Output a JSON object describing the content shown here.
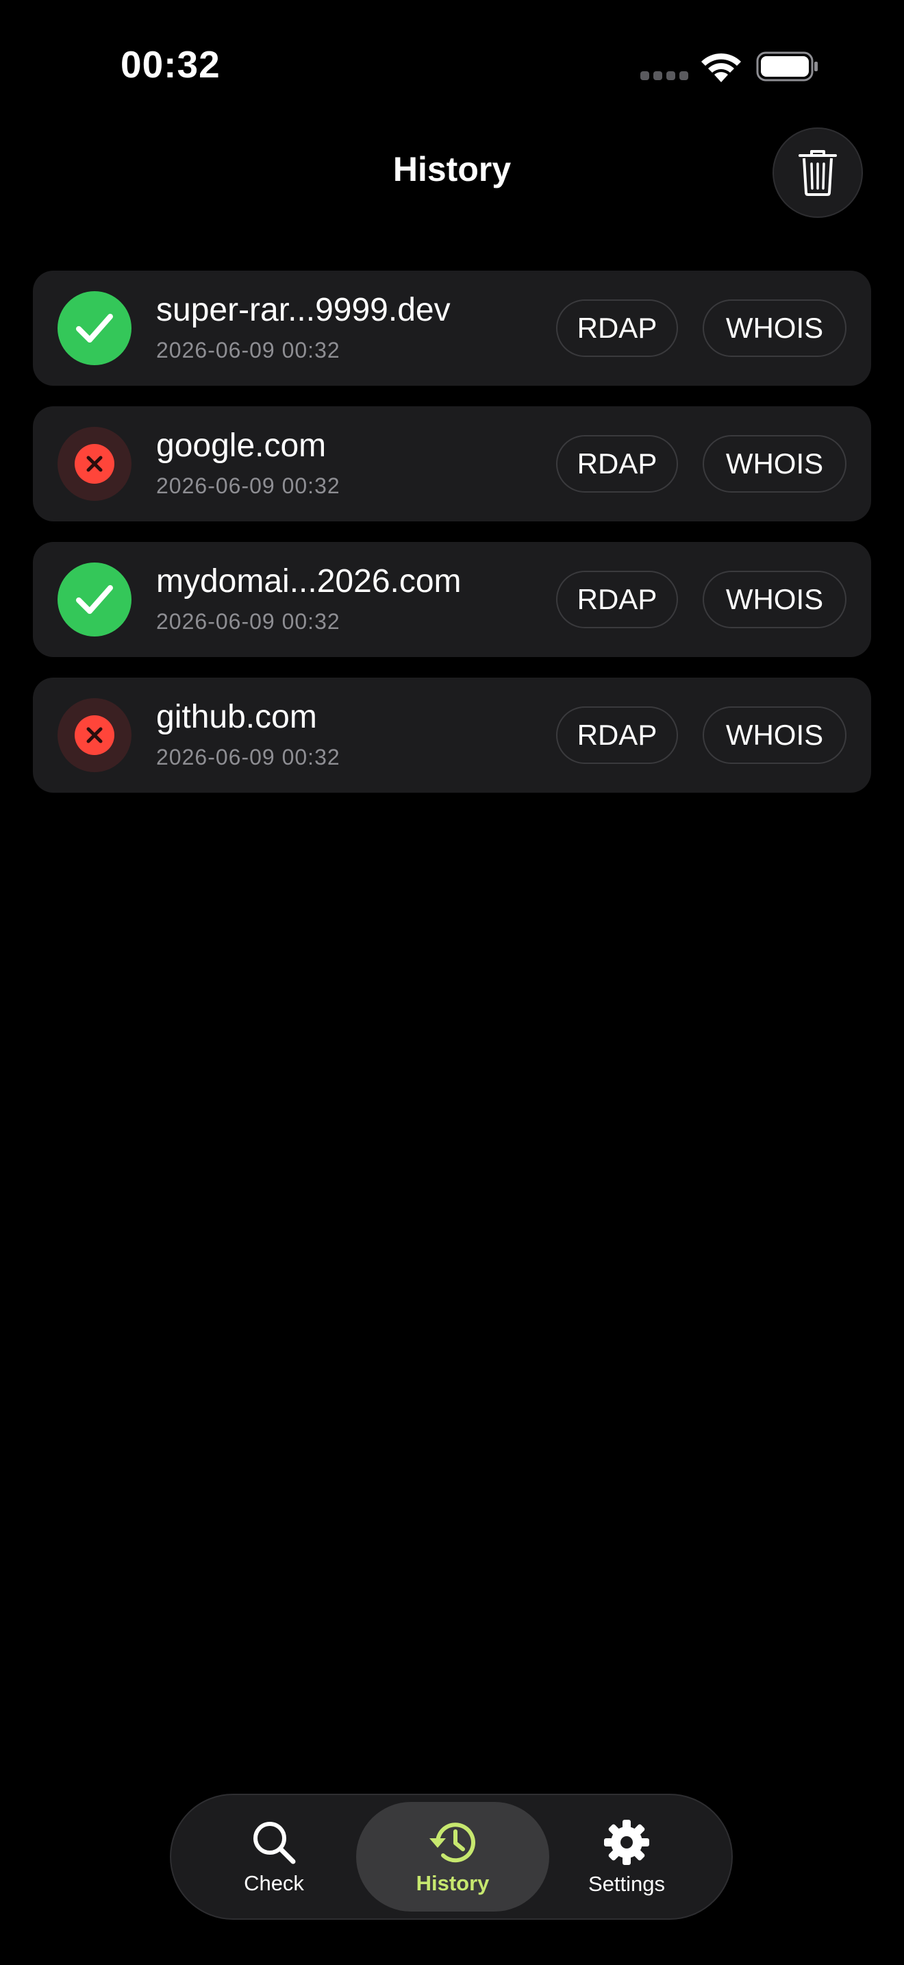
{
  "status_bar": {
    "time": "00:32"
  },
  "header": {
    "title": "History"
  },
  "history": [
    {
      "domain": "super-rar...9999.dev",
      "date": "2026-06-09 00:32",
      "status": "available",
      "rdap_label": "RDAP",
      "whois_label": "WHOIS"
    },
    {
      "domain": "google.com",
      "date": "2026-06-09 00:32",
      "status": "taken",
      "rdap_label": "RDAP",
      "whois_label": "WHOIS"
    },
    {
      "domain": "mydomai...2026.com",
      "date": "2026-06-09 00:32",
      "status": "available",
      "rdap_label": "RDAP",
      "whois_label": "WHOIS"
    },
    {
      "domain": "github.com",
      "date": "2026-06-09 00:32",
      "status": "taken",
      "rdap_label": "RDAP",
      "whois_label": "WHOIS"
    }
  ],
  "tab_bar": {
    "check": "Check",
    "history": "History",
    "settings": "Settings",
    "active": "history"
  },
  "colors": {
    "background": "#000000",
    "card": "#1c1c1e",
    "available": "#34c759",
    "taken": "#ff453a",
    "accent": "#c7e86f",
    "secondary_text": "#8e8e93"
  },
  "icons": {
    "header_action": "trash-icon",
    "available": "checkmark-icon",
    "taken": "xmark-icon",
    "check_tab": "magnifier-icon",
    "history_tab": "clock-arrow-icon",
    "settings_tab": "gear-icon"
  }
}
